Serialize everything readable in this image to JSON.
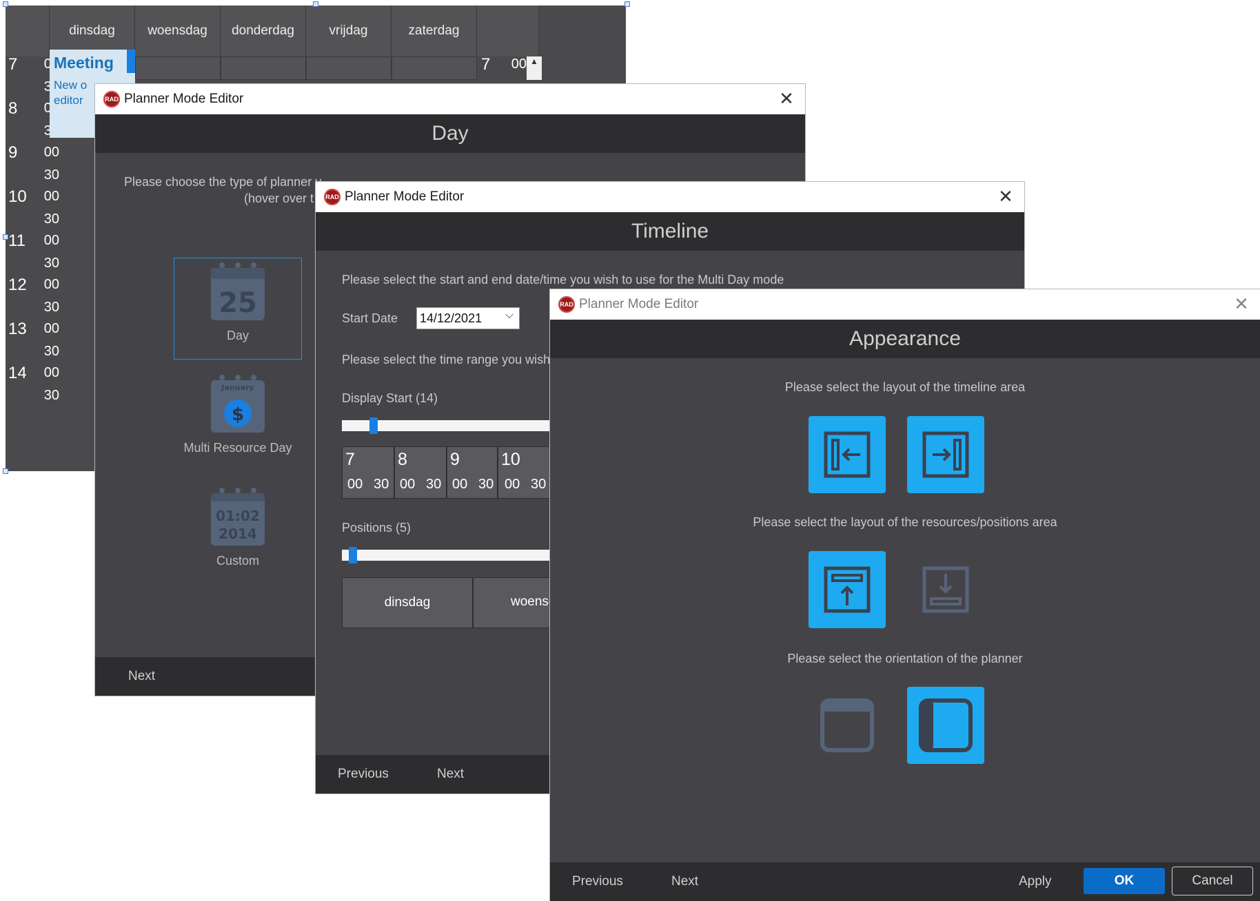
{
  "planner": {
    "days": [
      "dinsdag",
      "woensdag",
      "donderdag",
      "vrijdag",
      "zaterdag"
    ],
    "hours": [
      "7",
      "8",
      "9",
      "10",
      "11",
      "12",
      "13",
      "14"
    ],
    "minutes": [
      "00",
      "30"
    ],
    "right_hour": "7",
    "right_minute": "00",
    "appointment": {
      "title": "Meeting",
      "body_line1": "New o",
      "body_line2": "editor"
    }
  },
  "day_dialog": {
    "window_title": "Planner Mode Editor",
    "header": "Day",
    "instruction_line1": "Please choose the type of planner y",
    "instruction_line2": "(hover over t",
    "modes": [
      {
        "label": "Day",
        "icon": "calendar-25-icon",
        "icon_text": "25"
      },
      {
        "label": "Multi Resource Day",
        "icon": "calendar-money-icon",
        "icon_text": "January"
      },
      {
        "label": "Custom",
        "icon": "calendar-clock-icon",
        "icon_text_1": "01:02",
        "icon_text_2": "2014"
      }
    ],
    "next": "Next"
  },
  "timeline_dialog": {
    "window_title": "Planner Mode Editor",
    "header": "Timeline",
    "instruction": "Please select the start and end date/time you wish to use for the Multi Day mode",
    "start_date_label": "Start Date",
    "start_date_value": "14/12/2021",
    "time_range_text": "Please select the time range you wish",
    "display_start_label": "Display Start (14)",
    "display_start_value": 14,
    "preview_hours": [
      "7",
      "8",
      "9",
      "10"
    ],
    "preview_minutes": [
      "00",
      "30",
      "00",
      "30",
      "00",
      "30",
      "00",
      "30"
    ],
    "positions_label": "Positions (5)",
    "positions_value": 5,
    "preview_days": [
      "dinsdag",
      "woensd"
    ],
    "previous": "Previous",
    "next": "Next"
  },
  "appearance_dialog": {
    "window_title": "Planner Mode Editor",
    "header": "Appearance",
    "timeline_layout_text": "Please select the layout of the timeline area",
    "resources_layout_text": "Please select the layout of the resources/positions area",
    "orientation_text": "Please select the orientation of the planner",
    "previous": "Previous",
    "next": "Next",
    "apply": "Apply",
    "ok": "OK",
    "cancel": "Cancel"
  },
  "colors": {
    "accent": "#1eaaf1",
    "ok_button": "#0b6cc8",
    "dark_bg": "#444448",
    "header_bg": "#2d2d30",
    "selection": "#1a7fe0"
  }
}
